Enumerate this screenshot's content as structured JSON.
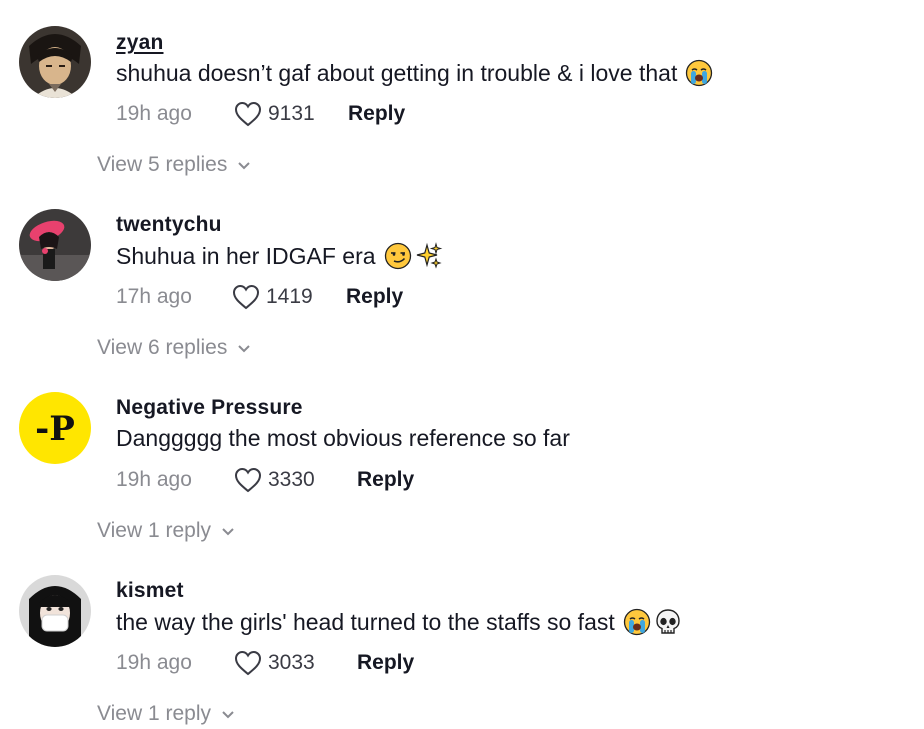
{
  "comments": [
    {
      "username": "zyan",
      "text": "shuhua doesn’t gaf about getting in trouble & i love that",
      "emojis": [
        "loudly-crying-face"
      ],
      "time": "19h ago",
      "likes": "9131",
      "reply_label": "Reply",
      "view_replies": "View 5 replies"
    },
    {
      "username": "twentychu",
      "text": "Shuhua in her IDGAF era",
      "emojis": [
        "smirking-face",
        "sparkles"
      ],
      "time": "17h ago",
      "likes": "1419",
      "reply_label": "Reply",
      "view_replies": "View 6 replies"
    },
    {
      "username": "Negative Pressure",
      "text": "Danggggg the most obvious reference so far",
      "emojis": [],
      "avatar_text": "-P",
      "time": "19h ago",
      "likes": "3330",
      "reply_label": "Reply",
      "view_replies": "View 1 reply"
    },
    {
      "username": "kismet",
      "text": "the way the girls' head turned to the staffs so fast",
      "emojis": [
        "loudly-crying-face",
        "skull"
      ],
      "time": "19h ago",
      "likes": "3033",
      "reply_label": "Reply",
      "view_replies": "View 1 reply"
    }
  ],
  "colors": {
    "text": "#161823",
    "muted": "#8a8b91",
    "avatar_yellow": "#ffe600"
  }
}
